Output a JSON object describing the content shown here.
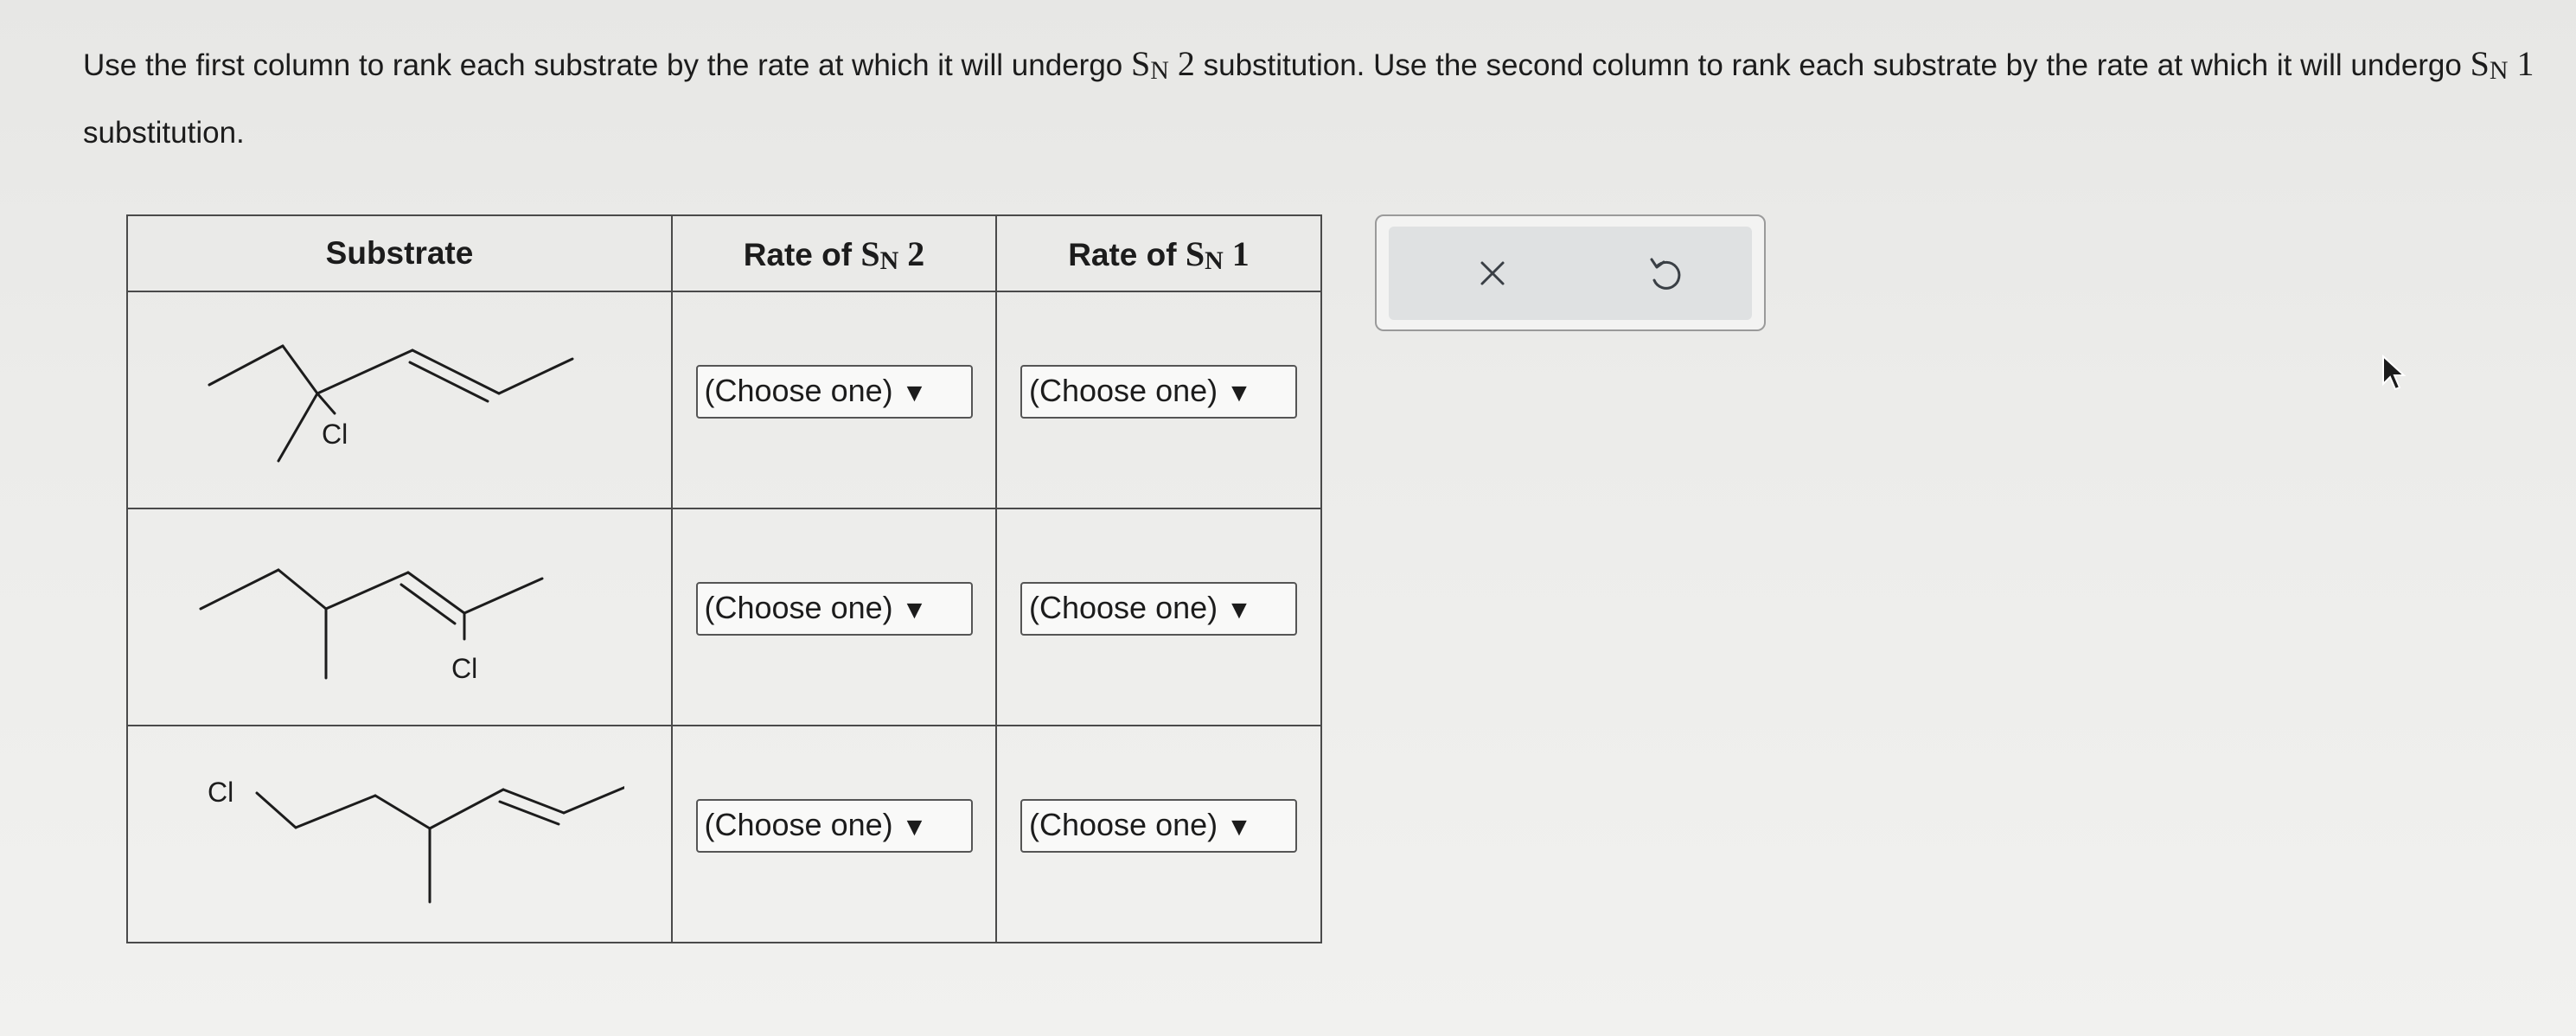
{
  "instructions": {
    "part1": "Use the first column to rank each substrate by the rate at which it will undergo ",
    "sn2_s": "S",
    "sn2_sub": "N",
    "sn2_num": " 2",
    "part2": " substitution. Use the second column to rank each substrate by the rate at which it will undergo ",
    "sn1_s": "S",
    "sn1_sub": "N",
    "sn1_num": " 1",
    "part3": " substitution."
  },
  "table": {
    "headers": {
      "substrate": "Substrate",
      "sn2_prefix": "Rate of ",
      "sn2_s": "S",
      "sn2_sub": "N",
      "sn2_num": " 2",
      "sn1_prefix": "Rate of ",
      "sn1_s": "S",
      "sn1_sub": "N",
      "sn1_num": " 1"
    },
    "rows": [
      {
        "substituent": "Cl",
        "sn2_select": "(Choose one)",
        "sn1_select": "(Choose one)"
      },
      {
        "substituent": "Cl",
        "sn2_select": "(Choose one)",
        "sn1_select": "(Choose one)"
      },
      {
        "substituent": "Cl",
        "sn2_select": "(Choose one)",
        "sn1_select": "(Choose one)"
      }
    ],
    "arrow_glyph": "▼"
  },
  "tools": {
    "clear_icon": "close-icon",
    "undo_icon": "undo-icon"
  },
  "colors": {
    "background": "#ececea",
    "border": "#4a4a4a",
    "tool_panel_bg": "#dfe1e2"
  }
}
